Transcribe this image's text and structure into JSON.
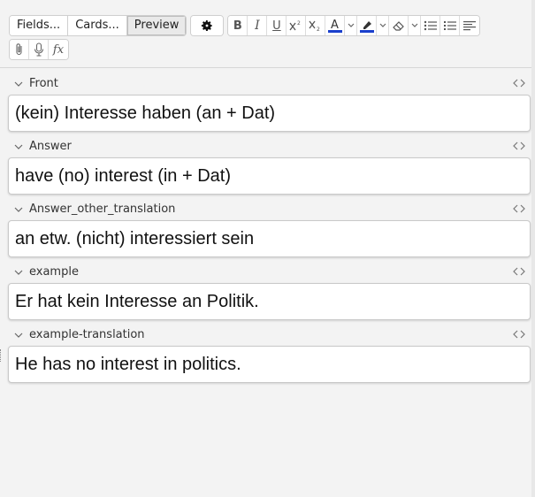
{
  "toolbar": {
    "mode_buttons": {
      "fields_label": "Fields...",
      "cards_label": "Cards...",
      "preview_label": "Preview"
    },
    "icons": [
      "gear-icon",
      "bold-icon",
      "italic-icon",
      "underline-icon",
      "superscript-icon",
      "subscript-icon",
      "text-color-icon",
      "highlight-icon",
      "eraser-icon",
      "bullet-list-icon",
      "numbered-list-icon",
      "align-icon",
      "paperclip-icon",
      "microphone-icon",
      "formula-icon"
    ],
    "text_color": "#1a3fcc",
    "highlight_color": "#1a3fcc",
    "glyphs": {
      "bold": "B",
      "italic": "I",
      "underline": "U",
      "text_color": "A",
      "formula": "fx"
    }
  },
  "fields": [
    {
      "label": "Front",
      "value": "(kein) Interesse haben (an + Dat)"
    },
    {
      "label": "Answer",
      "value": "have (no) interest (in + Dat)"
    },
    {
      "label": "Answer_other_translation",
      "value": "an etw. (nicht) interessiert sein"
    },
    {
      "label": "example",
      "value": "Er hat kein Interesse an Politik."
    },
    {
      "label": "example-translation",
      "value": "He has no interest in politics."
    }
  ],
  "field_toggle_glyph": "<>"
}
